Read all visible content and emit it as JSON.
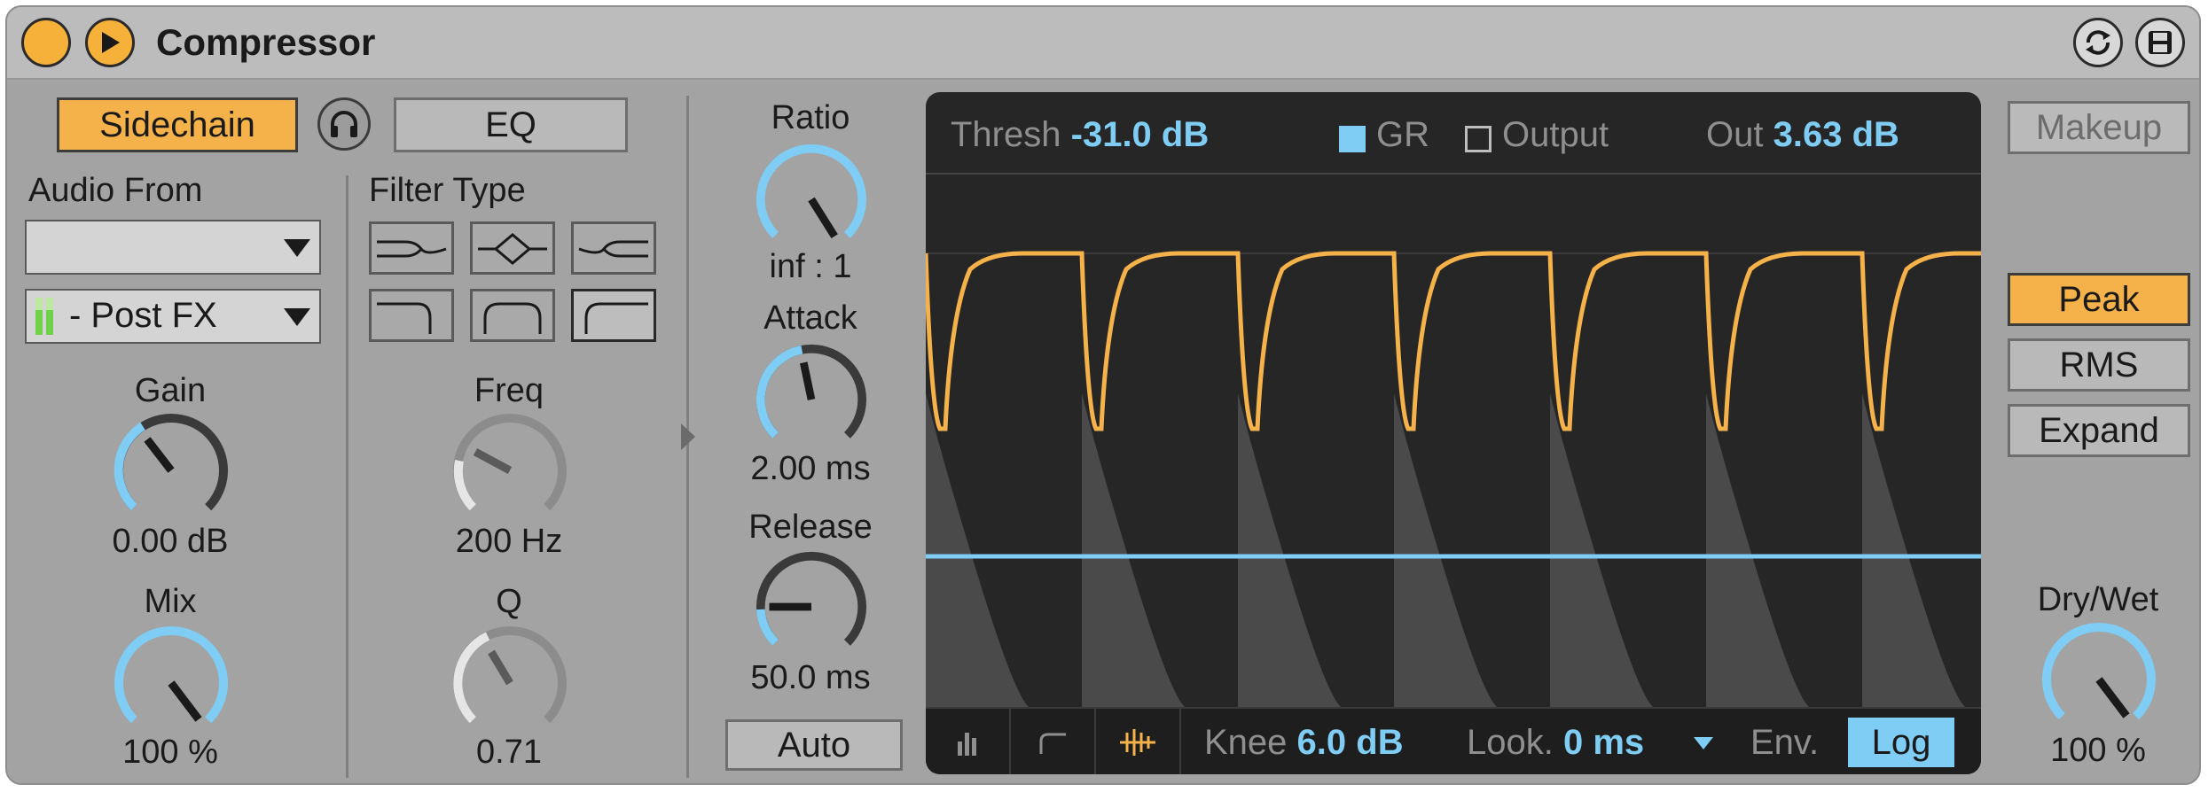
{
  "title": "Compressor",
  "sidechain": {
    "label": "Sidechain",
    "eq_label": "EQ"
  },
  "audio_from": {
    "label": "Audio From",
    "source_value": "",
    "tap_value": "- Post FX"
  },
  "gain": {
    "label": "Gain",
    "value": "0.00 dB",
    "level": 0.5
  },
  "mix": {
    "label": "Mix",
    "value": "100 %",
    "level": 1.0
  },
  "filter": {
    "label": "Filter Type",
    "types": [
      "lowpass-filter-icon",
      "bandpass-filter-icon",
      "highpass-filter-icon",
      "lowshelf-filter-icon",
      "peak-filter-icon",
      "highshelf-filter-icon"
    ]
  },
  "freq": {
    "label": "Freq",
    "value": "200 Hz"
  },
  "q": {
    "label": "Q",
    "value": "0.71"
  },
  "ratio": {
    "label": "Ratio",
    "value": "inf : 1"
  },
  "attack": {
    "label": "Attack",
    "value": "2.00 ms"
  },
  "release": {
    "label": "Release",
    "value": "50.0 ms"
  },
  "auto_label": "Auto",
  "display": {
    "thresh_label": "Thresh",
    "thresh_value": "-31.0 dB",
    "gr_label": "GR",
    "output_label": "Output",
    "out_label": "Out",
    "out_value": "3.63 dB",
    "knee_label": "Knee",
    "knee_value": "6.0 dB",
    "look_label": "Look.",
    "look_value": "0 ms",
    "env_label": "Env.",
    "env_value": "Log"
  },
  "modes": {
    "makeup": "Makeup",
    "peak": "Peak",
    "rms": "RMS",
    "expand": "Expand"
  },
  "dry_wet": {
    "label": "Dry/Wet",
    "value": "100 %"
  },
  "colors": {
    "accent_orange": "#f6b24a",
    "accent_blue": "#7fcdf5",
    "panel_bg": "#a3a3a3",
    "display_bg": "#262626"
  }
}
